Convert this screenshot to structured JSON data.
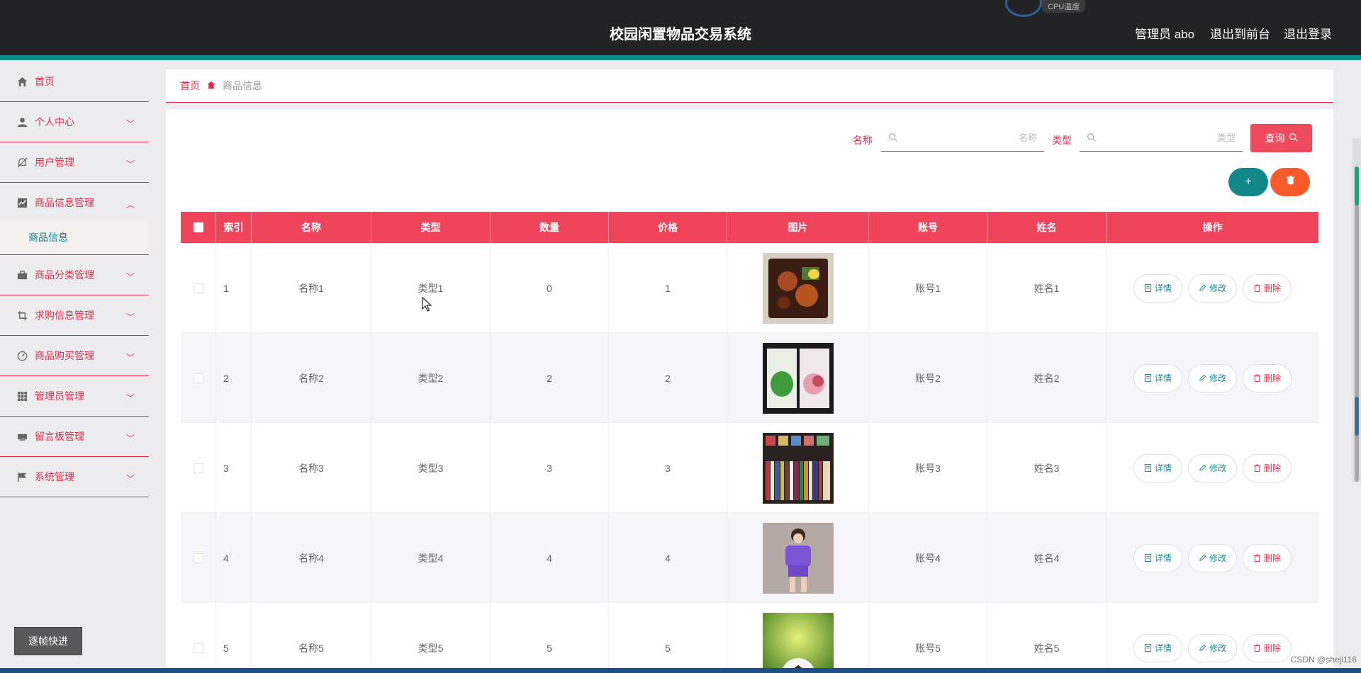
{
  "header": {
    "title": "校园闲置物品交易系统",
    "cpu_label": "CPU温度",
    "admin": "管理员 abo",
    "back_front": "退出到前台",
    "logout": "退出登录"
  },
  "sidebar": {
    "items": [
      {
        "label": "首页",
        "icon": "home-icon"
      },
      {
        "label": "个人中心",
        "icon": "user-icon"
      },
      {
        "label": "用户管理",
        "icon": "bell-off-icon"
      },
      {
        "label": "商品信息管理",
        "icon": "chart-icon"
      },
      {
        "label": "商品分类管理",
        "icon": "briefcase-icon"
      },
      {
        "label": "求购信息管理",
        "icon": "crop-icon"
      },
      {
        "label": "商品购买管理",
        "icon": "gauge-icon"
      },
      {
        "label": "管理员管理",
        "icon": "grid-icon"
      },
      {
        "label": "留言板管理",
        "icon": "printer-icon"
      },
      {
        "label": "系统管理",
        "icon": "flag-icon"
      }
    ],
    "sub_item": "商品信息",
    "frame_button": "逐帧快进"
  },
  "breadcrumb": {
    "home": "首页",
    "current": "商品信息"
  },
  "search": {
    "name_label": "名称",
    "name_placeholder": "名称",
    "type_label": "类型",
    "type_placeholder": "类型",
    "query_button": "查询"
  },
  "actions": {
    "add_symbol": "+"
  },
  "table": {
    "headers": [
      "索引",
      "名称",
      "类型",
      "数量",
      "价格",
      "图片",
      "账号",
      "姓名",
      "操作"
    ],
    "rows": [
      {
        "index": "1",
        "name": "名称1",
        "type": "类型1",
        "qty": "0",
        "price": "1",
        "account": "账号1",
        "person": "姓名1"
      },
      {
        "index": "2",
        "name": "名称2",
        "type": "类型2",
        "qty": "2",
        "price": "2",
        "account": "账号2",
        "person": "姓名2"
      },
      {
        "index": "3",
        "name": "名称3",
        "type": "类型3",
        "qty": "3",
        "price": "3",
        "account": "账号3",
        "person": "姓名3"
      },
      {
        "index": "4",
        "name": "名称4",
        "type": "类型4",
        "qty": "4",
        "price": "4",
        "account": "账号4",
        "person": "姓名4"
      },
      {
        "index": "5",
        "name": "名称5",
        "type": "类型5",
        "qty": "5",
        "price": "5",
        "account": "账号5",
        "person": "姓名5"
      }
    ],
    "ops": {
      "detail": "详情",
      "edit": "修改",
      "delete": "删除"
    }
  },
  "watermark": "CSDN @sheji116",
  "colors": {
    "header_bg": "#232325",
    "accent_teal": "#11878a",
    "primary_red": "#f0445c",
    "delete_orange": "#f85a2a"
  }
}
